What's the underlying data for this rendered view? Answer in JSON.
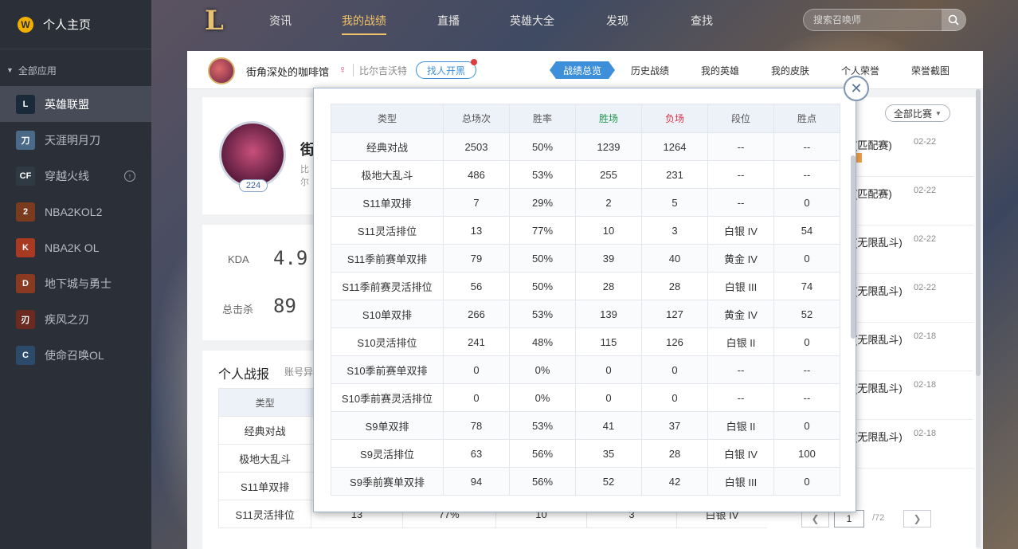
{
  "sidebar": {
    "home_label": "个人主页",
    "section_label": "全部应用",
    "items": [
      {
        "label": "英雄联盟",
        "color": "#1b2a3a",
        "glyph": "L"
      },
      {
        "label": "天涯明月刀",
        "color": "#4b6a8a",
        "glyph": "刀"
      },
      {
        "label": "穿越火线",
        "color": "#2f3a44",
        "glyph": "CF"
      },
      {
        "label": "NBA2KOL2",
        "color": "#7a3b1e",
        "glyph": "2"
      },
      {
        "label": "NBA2K OL",
        "color": "#a83a22",
        "glyph": "K"
      },
      {
        "label": "地下城与勇士",
        "color": "#8a3a20",
        "glyph": "D"
      },
      {
        "label": "疾风之刃",
        "color": "#6a2a20",
        "glyph": "刃"
      },
      {
        "label": "使命召唤OL",
        "color": "#2c4a6a",
        "glyph": "C"
      }
    ]
  },
  "topnav": {
    "items": [
      "资讯",
      "我的战绩",
      "直播",
      "英雄大全",
      "发现",
      "查找"
    ],
    "search_placeholder": "搜索召唤师"
  },
  "subbar": {
    "username": "街角深处的咖啡馆",
    "gender_icon": "♀",
    "server": "比尔吉沃特",
    "find_button": "找人开黑",
    "tabs": [
      "战绩总览",
      "历史战绩",
      "我的英雄",
      "我的皮肤",
      "个人荣誉",
      "荣誉截图"
    ]
  },
  "profile": {
    "name_fragment": "街",
    "sub_fragment": "比尔",
    "level": "224"
  },
  "stats": {
    "kda_label": "KDA",
    "kda_value": "4.9",
    "kills_label": "总击杀",
    "kills_value": "89"
  },
  "report": {
    "title": "个人战报",
    "sub": "账号异",
    "rows": [
      [
        "类型"
      ],
      [
        "经典对战"
      ],
      [
        "极地大乱斗"
      ],
      [
        "S11单双排"
      ],
      [
        "S11灵活排位"
      ]
    ],
    "partial_row": [
      "13",
      "77%",
      "10",
      "3",
      "白银 IV",
      "54"
    ]
  },
  "right": {
    "filter": "全部比赛",
    "matches": [
      {
        "type": "(匹配赛)",
        "date": "02-22"
      },
      {
        "type": "(匹配赛)",
        "date": "02-22"
      },
      {
        "type": "(无限乱斗)",
        "date": "02-22"
      },
      {
        "type": "(无限乱斗)",
        "date": "02-22"
      },
      {
        "type": "(无限乱斗)",
        "date": "02-18"
      },
      {
        "type": "(无限乱斗)",
        "date": "02-18"
      },
      {
        "type": "(无限乱斗)",
        "date": "02-18"
      }
    ],
    "pager_current": "1",
    "pager_total": "/72"
  },
  "popup": {
    "headers": [
      "类型",
      "总场次",
      "胜率",
      "胜场",
      "负场",
      "段位",
      "胜点"
    ],
    "rows": [
      [
        "经典对战",
        "2503",
        "50%",
        "1239",
        "1264",
        "--",
        "--"
      ],
      [
        "极地大乱斗",
        "486",
        "53%",
        "255",
        "231",
        "--",
        "--"
      ],
      [
        "S11单双排",
        "7",
        "29%",
        "2",
        "5",
        "--",
        "0"
      ],
      [
        "S11灵活排位",
        "13",
        "77%",
        "10",
        "3",
        "白银 IV",
        "54"
      ],
      [
        "S11季前赛单双排",
        "79",
        "50%",
        "39",
        "40",
        "黄金 IV",
        "0"
      ],
      [
        "S11季前赛灵活排位",
        "56",
        "50%",
        "28",
        "28",
        "白银 III",
        "74"
      ],
      [
        "S10单双排",
        "266",
        "53%",
        "139",
        "127",
        "黄金 IV",
        "52"
      ],
      [
        "S10灵活排位",
        "241",
        "48%",
        "115",
        "126",
        "白银 II",
        "0"
      ],
      [
        "S10季前赛单双排",
        "0",
        "0%",
        "0",
        "0",
        "--",
        "--"
      ],
      [
        "S10季前赛灵活排位",
        "0",
        "0%",
        "0",
        "0",
        "--",
        "--"
      ],
      [
        "S9单双排",
        "78",
        "53%",
        "41",
        "37",
        "白银 II",
        "0"
      ],
      [
        "S9灵活排位",
        "63",
        "56%",
        "35",
        "28",
        "白银 IV",
        "100"
      ],
      [
        "S9季前赛单双排",
        "94",
        "56%",
        "52",
        "42",
        "白银 III",
        "0"
      ]
    ]
  }
}
